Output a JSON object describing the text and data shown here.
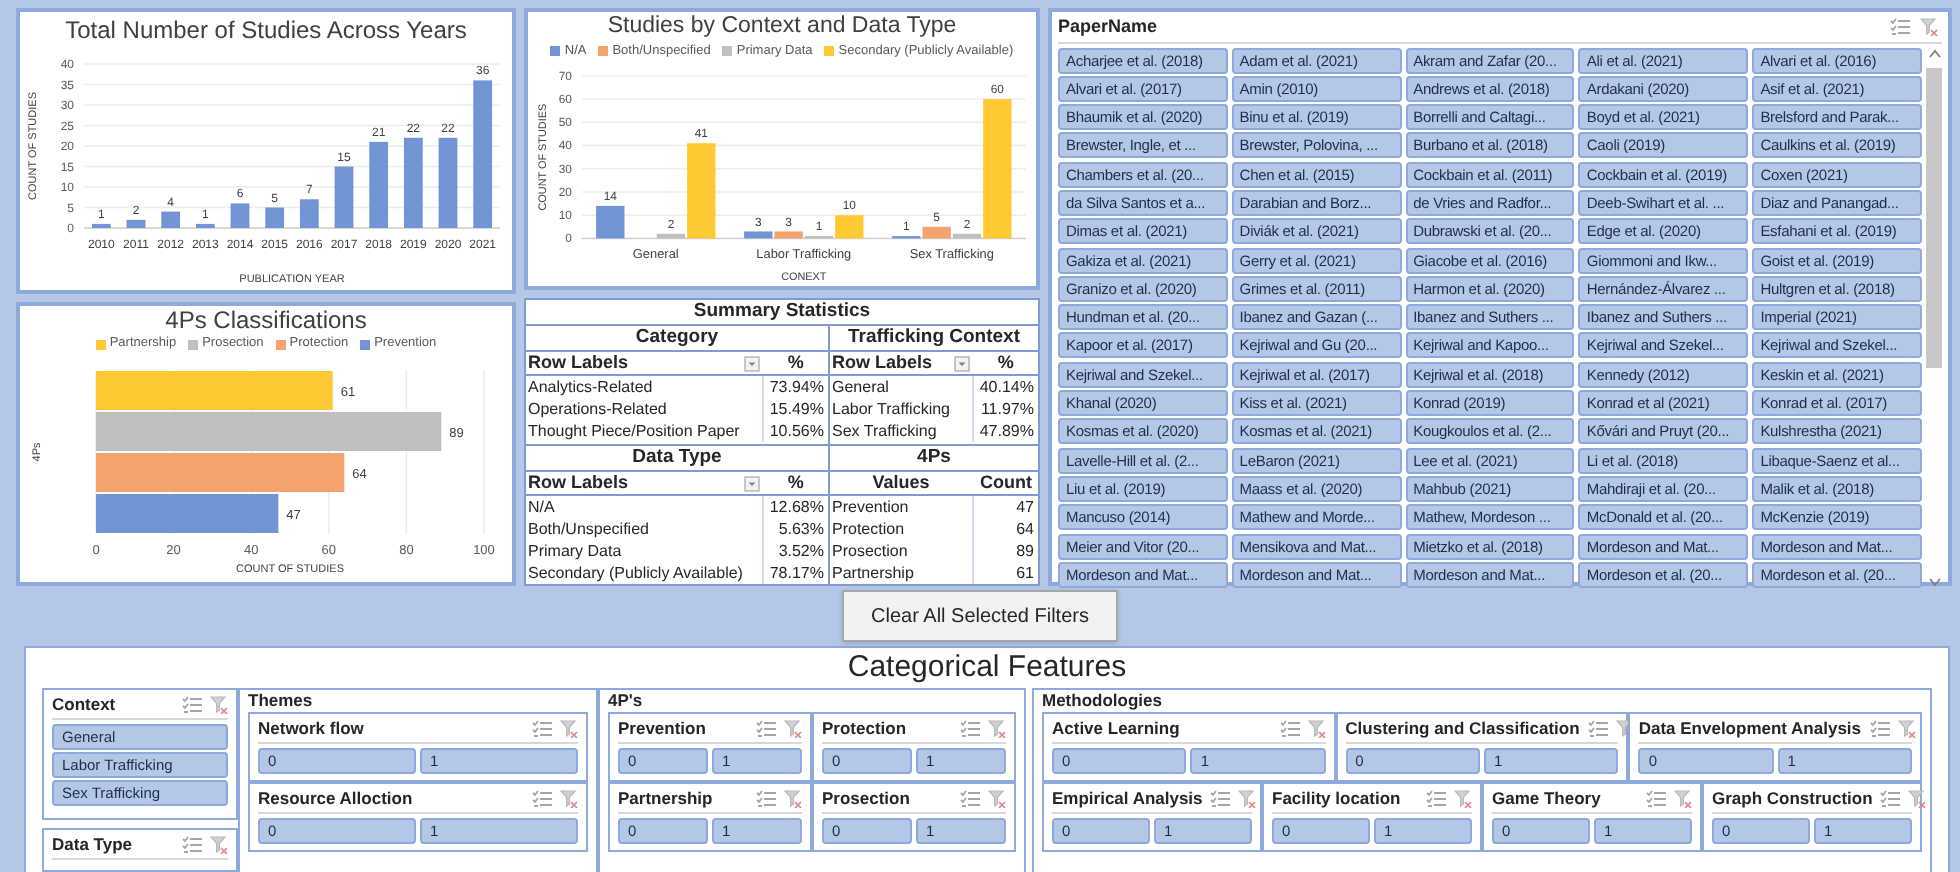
{
  "publication_chart": {
    "chart_data": {
      "type": "bar",
      "title": "Total Number of Studies Across Years",
      "xlabel": "PUBLICATION YEAR",
      "ylabel": "COUNT OF STUDIES",
      "categories": [
        "2010",
        "2011",
        "2012",
        "2013",
        "2014",
        "2015",
        "2016",
        "2017",
        "2018",
        "2019",
        "2020",
        "2021"
      ],
      "values": [
        1,
        2,
        4,
        1,
        6,
        5,
        7,
        15,
        21,
        22,
        22,
        36
      ],
      "ylim": [
        0,
        40
      ],
      "yticks": [
        0,
        5,
        10,
        15,
        20,
        25,
        30,
        35,
        40
      ],
      "grid": true,
      "data_labels": true
    }
  },
  "fourps_chart": {
    "chart_data": {
      "type": "bar",
      "orientation": "horizontal",
      "title": "4Ps Classifications",
      "xlabel": "COUNT OF STUDIES",
      "ylabel": "4Ps",
      "series": [
        {
          "name": "Partnership",
          "color": "#ffc933",
          "values": [
            61
          ]
        },
        {
          "name": "Prosection",
          "color": "#bfbfbf",
          "values": [
            89
          ]
        },
        {
          "name": "Protection",
          "color": "#f4a26e",
          "values": [
            64
          ]
        },
        {
          "name": "Prevention",
          "color": "#7094d4",
          "values": [
            47
          ]
        }
      ],
      "xlim": [
        0,
        100
      ],
      "xticks": [
        0,
        20,
        40,
        60,
        80,
        100
      ],
      "grid": true,
      "legend": true,
      "data_labels": true
    }
  },
  "context_chart": {
    "chart_data": {
      "type": "bar",
      "title": "Studies by Context and Data Type",
      "xlabel": "CONEXT",
      "ylabel": "COUNT OF STUDIES",
      "categories": [
        "General",
        "Labor Trafficking",
        "Sex Trafficking"
      ],
      "series": [
        {
          "name": "N/A",
          "color": "#7094d4",
          "values": [
            14,
            3,
            1
          ]
        },
        {
          "name": "Both/Unspecified",
          "color": "#f4a26e",
          "values": [
            null,
            3,
            5
          ]
        },
        {
          "name": "Primary Data",
          "color": "#bfbfbf",
          "values": [
            2,
            1,
            2
          ]
        },
        {
          "name": "Secondary (Publicly Available)",
          "color": "#ffc933",
          "values": [
            41,
            10,
            60
          ]
        }
      ],
      "ylim": [
        0,
        70
      ],
      "yticks": [
        0,
        10,
        20,
        30,
        40,
        50,
        60,
        70
      ],
      "grid": true,
      "legend": true,
      "data_labels": true
    }
  },
  "summary_statistics": {
    "title": "Summary Statistics",
    "sections": [
      {
        "title": "Category",
        "header": [
          "Row Labels",
          "%"
        ],
        "filter_button": true,
        "rows": [
          [
            "Analytics-Related",
            "73.94%"
          ],
          [
            "Operations-Related",
            "15.49%"
          ],
          [
            "Thought Piece/Position Paper",
            "10.56%"
          ]
        ]
      },
      {
        "title": "Trafficking Context",
        "header": [
          "Row Labels",
          "%"
        ],
        "filter_button": true,
        "rows": [
          [
            "General",
            "40.14%"
          ],
          [
            "Labor Trafficking",
            "11.97%"
          ],
          [
            "Sex Trafficking",
            "47.89%"
          ]
        ]
      },
      {
        "title": "Data Type",
        "header": [
          "Row Labels",
          "%"
        ],
        "filter_button": true,
        "rows": [
          [
            "N/A",
            "12.68%"
          ],
          [
            "Both/Unspecified",
            "5.63%"
          ],
          [
            "Primary Data",
            "3.52%"
          ],
          [
            "Secondary (Publicly Available)",
            "78.17%"
          ]
        ]
      },
      {
        "title": "4Ps",
        "header": [
          "Values",
          "Count"
        ],
        "filter_button": false,
        "rows": [
          [
            "Prevention",
            "47"
          ],
          [
            "Protection",
            "64"
          ],
          [
            "Prosection",
            "89"
          ],
          [
            "Partnership",
            "61"
          ]
        ]
      }
    ]
  },
  "paper_slicer": {
    "title": "PaperName",
    "items": [
      {
        "label": "Acharjee et al. (2018)",
        "selected": true
      },
      {
        "label": "Adam et al. (2021)",
        "selected": true
      },
      {
        "label": "Akram and Zafar (20...",
        "selected": true
      },
      {
        "label": "Ali et al. (2021)",
        "selected": true
      },
      {
        "label": "Alvari et al. (2016)",
        "selected": true
      },
      {
        "label": "Alvari et al. (2017)",
        "selected": true
      },
      {
        "label": "Amin (2010)",
        "selected": true
      },
      {
        "label": "Andrews et al. (2018)",
        "selected": true
      },
      {
        "label": "Ardakani (2020)",
        "selected": true
      },
      {
        "label": "Asif et al. (2021)",
        "selected": true
      },
      {
        "label": "Bhaumik et al. (2020)",
        "selected": true
      },
      {
        "label": "Binu et al. (2019)",
        "selected": true
      },
      {
        "label": "Borrelli and Caltagi...",
        "selected": true
      },
      {
        "label": "Boyd et al. (2021)",
        "selected": true
      },
      {
        "label": "Brelsford and Parak...",
        "selected": true
      },
      {
        "label": "Brewster, Ingle, et ...",
        "selected": true
      },
      {
        "label": "Brewster, Polovina, ...",
        "selected": true
      },
      {
        "label": "Burbano et al. (2018)",
        "selected": true
      },
      {
        "label": "Caoli (2019)",
        "selected": true
      },
      {
        "label": "Caulkins et al. (2019)",
        "selected": true
      },
      {
        "label": "Chambers et al. (20...",
        "selected": true
      },
      {
        "label": "Chen et al. (2015)",
        "selected": true
      },
      {
        "label": "Cockbain et al. (2011)",
        "selected": true
      },
      {
        "label": "Cockbain et al. (2019)",
        "selected": true
      },
      {
        "label": "Coxen (2021)",
        "selected": true
      },
      {
        "label": "da Silva Santos et a...",
        "selected": true
      },
      {
        "label": "Darabian and Borz...",
        "selected": true
      },
      {
        "label": "de Vries and Radfor...",
        "selected": true
      },
      {
        "label": "Deeb-Swihart et al. ...",
        "selected": true
      },
      {
        "label": "Diaz and Panangad...",
        "selected": true
      },
      {
        "label": "Dimas et al. (2021)",
        "selected": true
      },
      {
        "label": "Diviák et al. (2021)",
        "selected": true
      },
      {
        "label": "Dubrawski et al. (20...",
        "selected": true
      },
      {
        "label": "Edge et al. (2020)",
        "selected": true
      },
      {
        "label": "Esfahani et al. (2019)",
        "selected": true
      },
      {
        "label": "Gakiza et al. (2021)",
        "selected": true
      },
      {
        "label": "Gerry et al. (2021)",
        "selected": true
      },
      {
        "label": "Giacobe et al. (2016)",
        "selected": true
      },
      {
        "label": "Giommoni and Ikw...",
        "selected": true
      },
      {
        "label": "Goist et al. (2019)",
        "selected": true
      },
      {
        "label": "Granizo et al. (2020)",
        "selected": true
      },
      {
        "label": "Grimes et al. (2011)",
        "selected": true
      },
      {
        "label": "Harmon et al. (2020)",
        "selected": true
      },
      {
        "label": "Hernández-Álvarez ...",
        "selected": true
      },
      {
        "label": "Hultgren et al. (2018)",
        "selected": true
      },
      {
        "label": "Hundman et al. (20...",
        "selected": true
      },
      {
        "label": "Ibanez and Gazan (...",
        "selected": true
      },
      {
        "label": "Ibanez and Suthers ...",
        "selected": true
      },
      {
        "label": "Ibanez and Suthers ...",
        "selected": true
      },
      {
        "label": "Imperial (2021)",
        "selected": true
      },
      {
        "label": "Kapoor et al. (2017)",
        "selected": true
      },
      {
        "label": "Kejriwal and Gu (20...",
        "selected": true
      },
      {
        "label": "Kejriwal and Kapoo...",
        "selected": true
      },
      {
        "label": "Kejriwal and Szekel...",
        "selected": true
      },
      {
        "label": "Kejriwal and Szekel...",
        "selected": true
      },
      {
        "label": "Kejriwal and Szekel...",
        "selected": true
      },
      {
        "label": "Kejriwal et al. (2017)",
        "selected": true
      },
      {
        "label": "Kejriwal et al. (2018)",
        "selected": true
      },
      {
        "label": "Kennedy (2012)",
        "selected": true
      },
      {
        "label": "Keskin et al. (2021)",
        "selected": true
      },
      {
        "label": "Khanal (2020)",
        "selected": true
      },
      {
        "label": "Kiss et al. (2021)",
        "selected": true
      },
      {
        "label": "Konrad (2019)",
        "selected": true
      },
      {
        "label": "Konrad et al (2021)",
        "selected": true
      },
      {
        "label": "Konrad et al. (2017)",
        "selected": true
      },
      {
        "label": "Kosmas et al. (2020)",
        "selected": true
      },
      {
        "label": "Kosmas et al. (2021)",
        "selected": true
      },
      {
        "label": "Kougkoulos et al. (2...",
        "selected": true
      },
      {
        "label": "Kővári and Pruyt (20...",
        "selected": true
      },
      {
        "label": "Kulshrestha (2021)",
        "selected": true
      },
      {
        "label": "Lavelle-Hill et al. (2...",
        "selected": true
      },
      {
        "label": "LeBaron (2021)",
        "selected": true
      },
      {
        "label": "Lee et al. (2021)",
        "selected": true
      },
      {
        "label": "Li et al. (2018)",
        "selected": true
      },
      {
        "label": "Libaque-Saenz et al...",
        "selected": true
      },
      {
        "label": "Liu et al. (2019)",
        "selected": true
      },
      {
        "label": "Maass et al. (2020)",
        "selected": true
      },
      {
        "label": "Mahbub (2021)",
        "selected": true
      },
      {
        "label": "Mahdiraji et al. (20...",
        "selected": true
      },
      {
        "label": "Malik et al. (2018)",
        "selected": true
      },
      {
        "label": "Mancuso (2014)",
        "selected": true
      },
      {
        "label": "Mathew and Morde...",
        "selected": true
      },
      {
        "label": "Mathew, Mordeson ...",
        "selected": true
      },
      {
        "label": "McDonald et al. (20...",
        "selected": true
      },
      {
        "label": "McKenzie (2019)",
        "selected": true
      },
      {
        "label": "Meier and Vitor (20...",
        "selected": true
      },
      {
        "label": "Mensikova and Mat...",
        "selected": true
      },
      {
        "label": "Mietzko et al. (2018)",
        "selected": true
      },
      {
        "label": "Mordeson and Mat...",
        "selected": true
      },
      {
        "label": "Mordeson and Mat...",
        "selected": true
      },
      {
        "label": "Mordeson and Mat...",
        "selected": true
      },
      {
        "label": "Mordeson and Mat...",
        "selected": true
      },
      {
        "label": "Mordeson and Mat...",
        "selected": true
      },
      {
        "label": "Mordeson et al. (20...",
        "selected": true
      },
      {
        "label": "Mordeson et al. (20...",
        "selected": true
      }
    ]
  },
  "clear_button": {
    "label": "Clear All Selected Filters"
  },
  "categorical_features": {
    "title": "Categorical Features",
    "context_slicer": {
      "title": "Context",
      "items": [
        {
          "label": "General",
          "selected": true
        },
        {
          "label": "Labor Trafficking",
          "selected": true
        },
        {
          "label": "Sex Trafficking",
          "selected": true
        }
      ]
    },
    "data_type_slicer": {
      "title": "Data Type"
    },
    "groups": [
      {
        "title": "Themes",
        "lines": [
          {
            "slicers": [
              {
                "title": "Network flow",
                "items": [
                  {
                    "label": "0",
                    "selected": true
                  },
                  {
                    "label": "1",
                    "selected": true
                  }
                ]
              }
            ]
          },
          {
            "slicers": [
              {
                "title": "Resource Alloction",
                "items": [
                  {
                    "label": "0",
                    "selected": true
                  },
                  {
                    "label": "1",
                    "selected": true
                  }
                ]
              }
            ]
          }
        ]
      },
      {
        "title": "4P's",
        "lines": [
          {
            "slicers": [
              {
                "title": "Prevention",
                "items": [
                  {
                    "label": "0",
                    "selected": true
                  },
                  {
                    "label": "1",
                    "selected": true
                  }
                ]
              },
              {
                "title": "Protection",
                "items": [
                  {
                    "label": "0",
                    "selected": true
                  },
                  {
                    "label": "1",
                    "selected": true
                  }
                ]
              }
            ]
          },
          {
            "slicers": [
              {
                "title": "Partnership",
                "items": [
                  {
                    "label": "0",
                    "selected": true
                  },
                  {
                    "label": "1",
                    "selected": true
                  }
                ]
              },
              {
                "title": "Prosection",
                "items": [
                  {
                    "label": "0",
                    "selected": true
                  },
                  {
                    "label": "1",
                    "selected": true
                  }
                ]
              }
            ]
          }
        ]
      },
      {
        "title": "Methodologies",
        "lines": [
          {
            "slicers": [
              {
                "title": "Active Learning",
                "items": [
                  {
                    "label": "0",
                    "selected": true
                  },
                  {
                    "label": "1",
                    "selected": true
                  }
                ]
              },
              {
                "title": "Clustering and Classification",
                "items": [
                  {
                    "label": "0",
                    "selected": true
                  },
                  {
                    "label": "1",
                    "selected": true
                  }
                ]
              },
              {
                "title": "Data Envelopment Analysis",
                "items": [
                  {
                    "label": "0",
                    "selected": true
                  },
                  {
                    "label": "1",
                    "selected": true
                  }
                ]
              }
            ]
          },
          {
            "slicers": [
              {
                "title": "Empirical Analysis",
                "items": [
                  {
                    "label": "0",
                    "selected": true
                  },
                  {
                    "label": "1",
                    "selected": true
                  }
                ]
              },
              {
                "title": "Facility location",
                "items": [
                  {
                    "label": "0",
                    "selected": true
                  },
                  {
                    "label": "1",
                    "selected": true
                  }
                ]
              },
              {
                "title": "Game Theory",
                "items": [
                  {
                    "label": "0",
                    "selected": true
                  },
                  {
                    "label": "1",
                    "selected": true
                  }
                ]
              },
              {
                "title": "Graph Construction",
                "items": [
                  {
                    "label": "0",
                    "selected": true
                  },
                  {
                    "label": "1",
                    "selected": true
                  }
                ]
              }
            ]
          }
        ]
      }
    ]
  }
}
